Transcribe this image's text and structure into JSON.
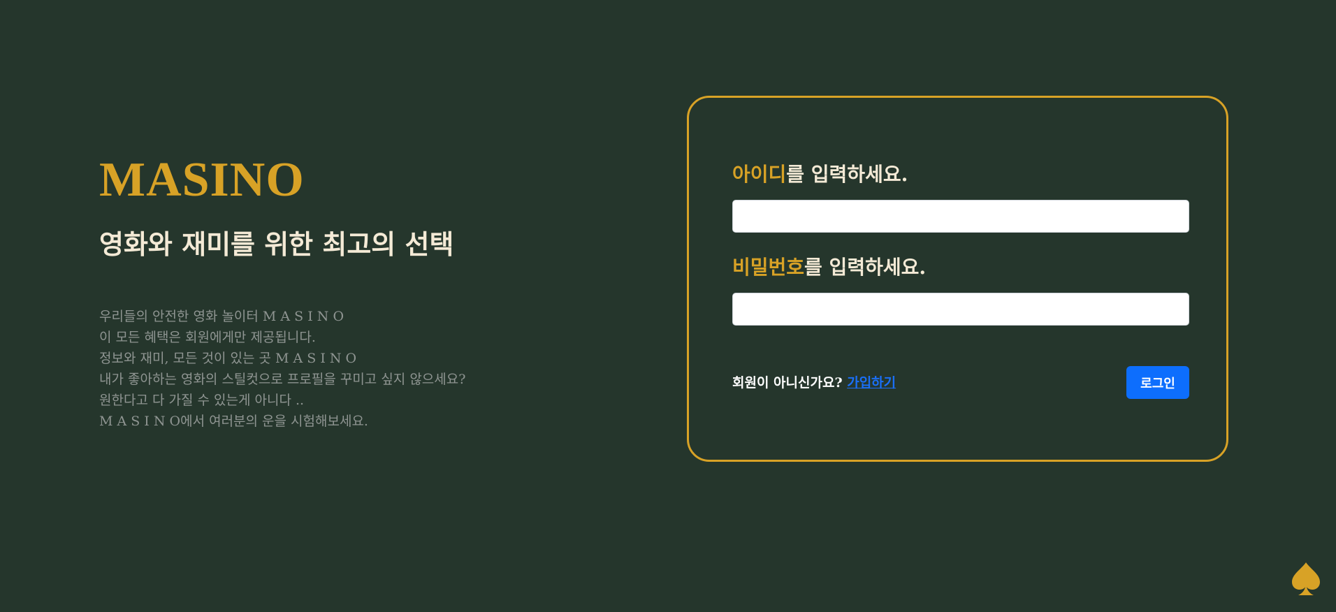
{
  "brand": {
    "title": "MASINO",
    "tagline": "영화와 재미를 위한 최고의 선택"
  },
  "intro": {
    "lines": [
      "우리들의 안전한 영화 놀이터 M A S I N O",
      "이 모든 혜택은 회원에게만 제공됩니다.",
      "정보와 재미, 모든 것이 있는 곳 M A S I N O",
      "내가 좋아하는 영화의 스틸컷으로 프로필을 꾸미고 싶지 않으세요?",
      "원한다고 다 가질 수 있는게 아니다 ..",
      "M A S I N O에서 여러분의 운을 시험해보세요."
    ]
  },
  "login": {
    "id_label_accent": "아이디",
    "id_label_rest": "를 입력하세요.",
    "id_value": "",
    "pw_label_accent": "비밀번호",
    "pw_label_rest": "를 입력하세요.",
    "pw_value": "",
    "signup_prompt": "회원이 아니신가요?",
    "signup_link": "가입하기",
    "submit_label": "로그인"
  },
  "decor": {
    "corner_icon": "spade-icon"
  },
  "colors": {
    "background": "#25362c",
    "accent_gold": "#d8a226",
    "heading_text": "#f4ead6",
    "muted_text": "#8f9592",
    "primary_button": "#0d6efd",
    "link": "#1a6ff6"
  }
}
